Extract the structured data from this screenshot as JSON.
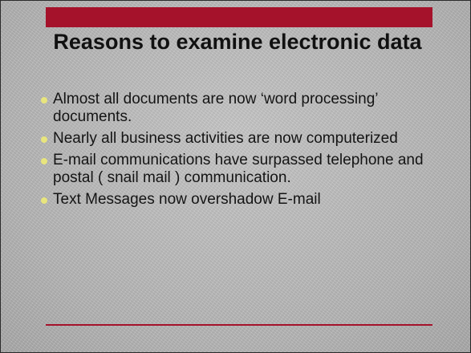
{
  "slide": {
    "title": "Reasons to examine electronic data",
    "bullets": [
      "Almost all documents are now ‘word processing’ documents.",
      "Nearly all business activities are now computerized",
      "E-mail communications have surpassed telephone and postal ( snail mail ) communication.",
      "Text Messages now overshadow E-mail"
    ]
  },
  "colors": {
    "accent_bar": "#a5122b",
    "bullet_dot": "#e8e57d",
    "background": "#b9b9b9",
    "text": "#111111"
  }
}
